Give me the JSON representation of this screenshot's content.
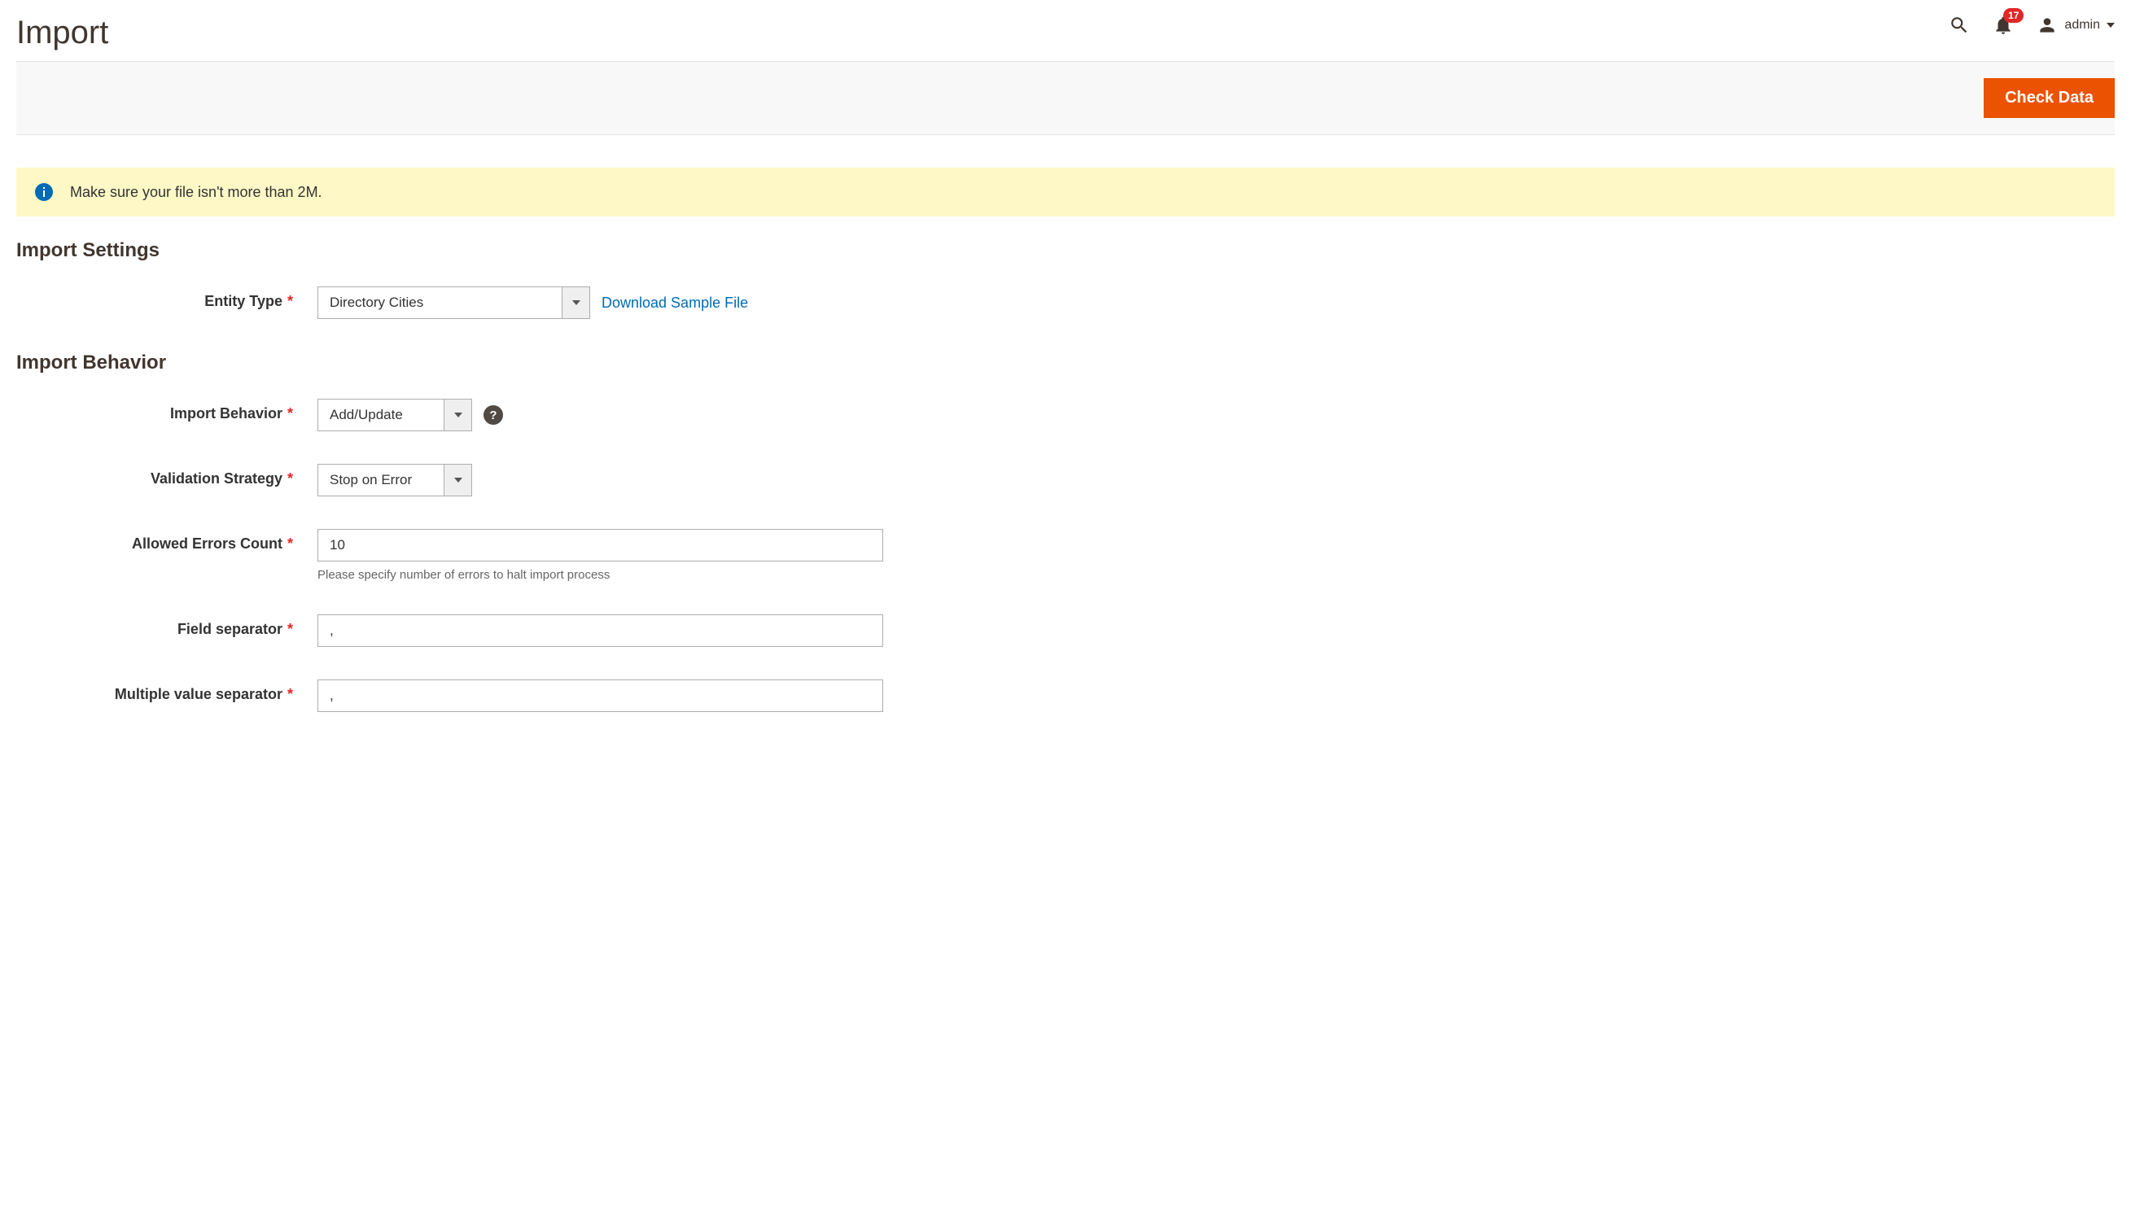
{
  "header": {
    "title": "Import",
    "notification_count": "17",
    "user_label": "admin"
  },
  "toolbar": {
    "check_data_label": "Check Data"
  },
  "notice": {
    "text": "Make sure your file isn't more than 2M."
  },
  "sections": {
    "import_settings_title": "Import Settings",
    "import_behavior_title": "Import Behavior"
  },
  "fields": {
    "entity_type": {
      "label": "Entity Type",
      "value": "Directory Cities",
      "download_link": "Download Sample File"
    },
    "import_behavior": {
      "label": "Import Behavior",
      "value": "Add/Update"
    },
    "validation_strategy": {
      "label": "Validation Strategy",
      "value": "Stop on Error"
    },
    "allowed_errors": {
      "label": "Allowed Errors Count",
      "value": "10",
      "note": "Please specify number of errors to halt import process"
    },
    "field_separator": {
      "label": "Field separator",
      "value": ","
    },
    "multi_separator": {
      "label": "Multiple value separator",
      "value": ","
    }
  }
}
